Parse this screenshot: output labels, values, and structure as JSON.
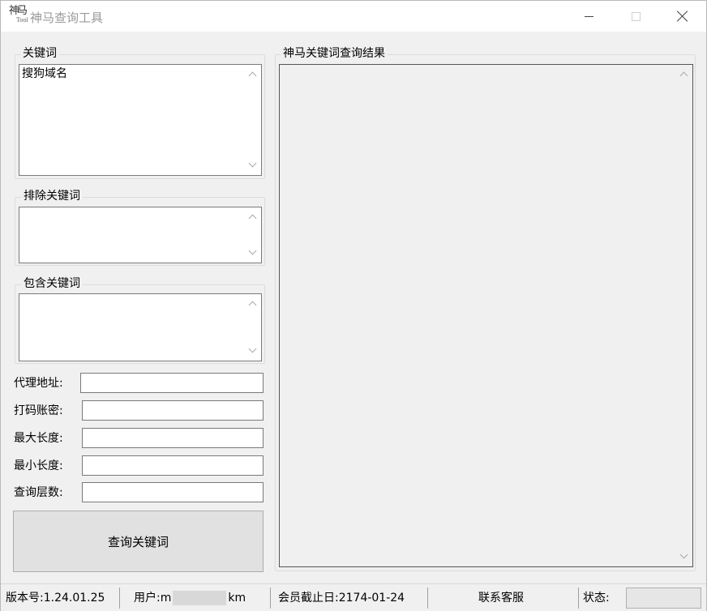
{
  "window": {
    "title": "神马查询工具",
    "icon_name": "app-logo-icon",
    "icon_glyphs": [
      "神",
      "马",
      "Tool"
    ]
  },
  "keyword_group": {
    "label": "关键词",
    "value": "搜狗域名"
  },
  "exclude_group": {
    "label": "排除关键词",
    "value": ""
  },
  "include_group": {
    "label": "包含关键词",
    "value": ""
  },
  "form": {
    "proxy_label": "代理地址:",
    "proxy_value": "",
    "captcha_label": "打码账密:",
    "captcha_value": "",
    "max_length_label": "最大长度:",
    "max_length_value": "",
    "min_length_label": "最小长度:",
    "min_length_value": "",
    "depth_label": "查询层数:",
    "depth_value": ""
  },
  "query_button": "查询关键词",
  "results": {
    "label": "神马关键词查询结果",
    "value": ""
  },
  "statusbar": {
    "version": "版本号:1.24.01.25",
    "user_prefix": "用户:m",
    "user_suffix": "km",
    "expiry": "会员截止日:2174-01-24",
    "contact": "联系客服",
    "status_label": "状态:"
  }
}
